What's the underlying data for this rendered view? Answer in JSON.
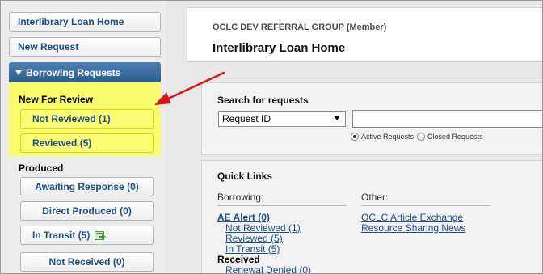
{
  "sidebar": {
    "home_label": "Interlibrary Loan Home",
    "new_request_label": "New Request",
    "section_label": "Borrowing Requests",
    "new_for_review_label": "New For Review",
    "not_reviewed_label": "Not Reviewed (1)",
    "reviewed_label": "Reviewed (5)",
    "produced_label": "Produced",
    "awaiting_label": "Awaiting Response (0)",
    "direct_produced_label": "Direct Produced (0)",
    "in_transit_label": "In Transit (5)",
    "not_received_label": "Not Received (0)"
  },
  "header": {
    "org": "OCLC DEV REFERRAL GROUP (Member)",
    "title": "Interlibrary Loan Home"
  },
  "search": {
    "label": "Search for requests",
    "field_value": "Request ID",
    "input_value": "",
    "active_label": "Active Requests",
    "closed_label": "Closed Requests"
  },
  "quick_links": {
    "title": "Quick Links",
    "borrowing_head": "Borrowing:",
    "other_head": "Other:",
    "ae_alert": "AE Alert (0)",
    "not_reviewed": "Not Reviewed (1)",
    "reviewed": "Reviewed (5)",
    "in_transit": "In Transit (5)",
    "received_head": "Received",
    "renewal_denied": "Renewal Denied (0)",
    "article_exchange": "OCLC Article Exchange",
    "resource_sharing": "Resource Sharing News"
  },
  "colors": {
    "highlight": "#fafa6e",
    "annotation_arrow": "#d9141b",
    "link": "#1f4e8c"
  }
}
